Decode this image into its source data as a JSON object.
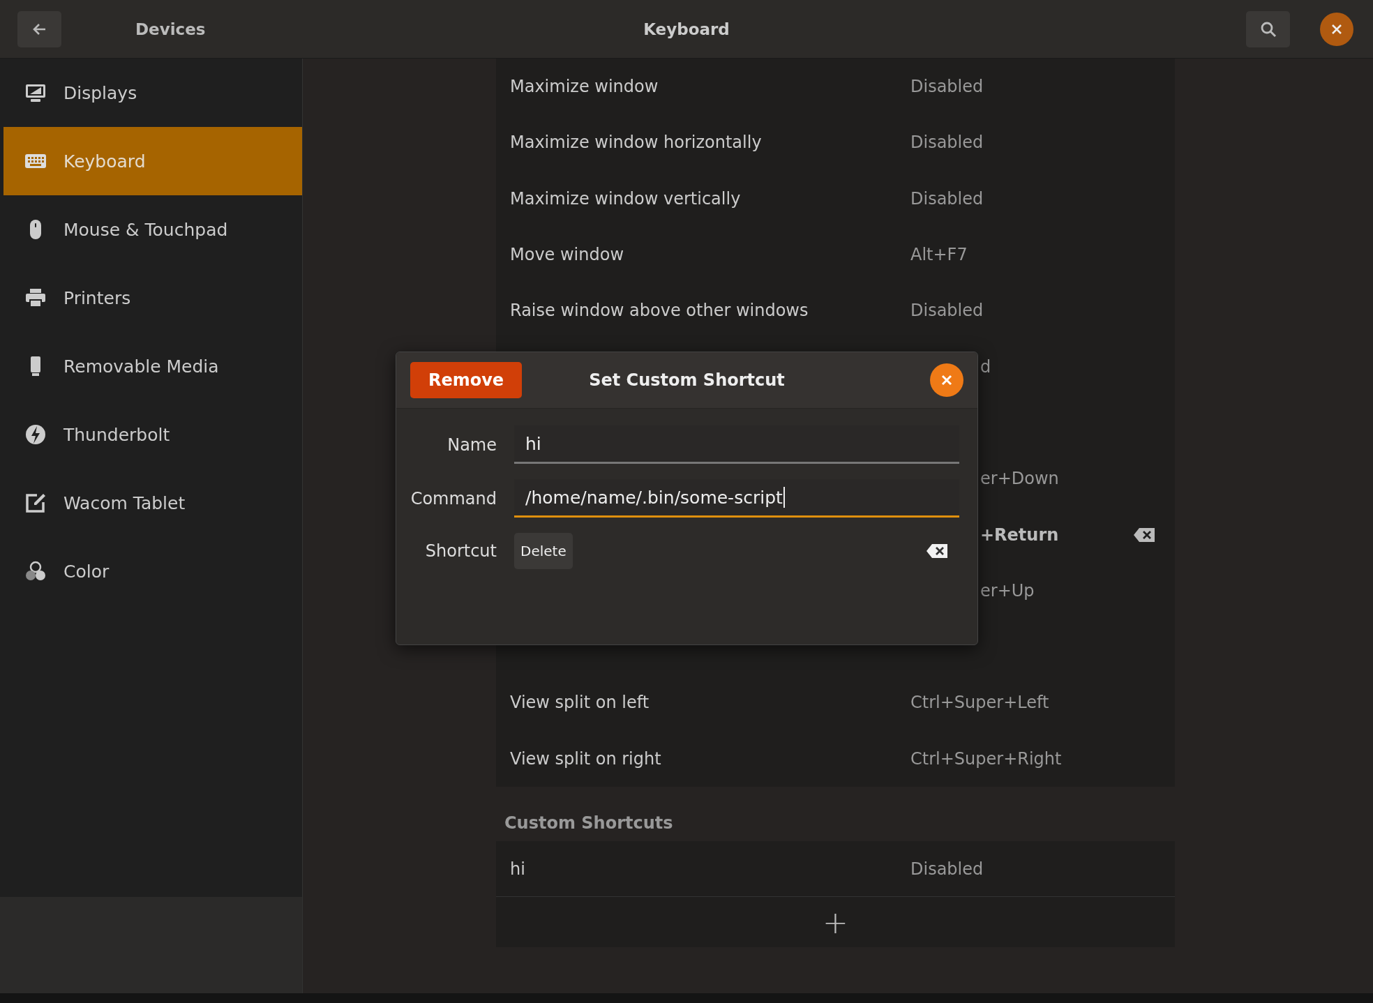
{
  "header": {
    "back_label": "Devices",
    "title": "Keyboard"
  },
  "sidebar": {
    "items": [
      {
        "label": "Displays",
        "kind": "display",
        "selected": false
      },
      {
        "label": "Keyboard",
        "kind": "keyboard",
        "selected": true
      },
      {
        "label": "Mouse & Touchpad",
        "kind": "mouse",
        "selected": false
      },
      {
        "label": "Printers",
        "kind": "printer",
        "selected": false
      },
      {
        "label": "Removable Media",
        "kind": "media",
        "selected": false
      },
      {
        "label": "Thunderbolt",
        "kind": "bolt",
        "selected": false
      },
      {
        "label": "Wacom Tablet",
        "kind": "tablet",
        "selected": false
      },
      {
        "label": "Color",
        "kind": "color",
        "selected": false
      }
    ]
  },
  "shortcuts": {
    "rows": [
      {
        "kind": "normal",
        "name": "Maximize window",
        "shortcut": "Disabled"
      },
      {
        "kind": "normal",
        "name": "Maximize window horizontally",
        "shortcut": "Disabled"
      },
      {
        "kind": "normal",
        "name": "Maximize window vertically",
        "shortcut": "Disabled"
      },
      {
        "kind": "normal",
        "name": "Move window",
        "shortcut": "Alt+F7"
      },
      {
        "kind": "normal",
        "name": "Raise window above other windows",
        "shortcut": "Disabled"
      },
      {
        "kind": "covered",
        "shortcut": "d"
      },
      {
        "kind": "hidden"
      },
      {
        "kind": "covered",
        "shortcut": "er+Down"
      },
      {
        "kind": "editing",
        "shortcut": "+Return"
      },
      {
        "kind": "covered",
        "shortcut": "er+Up"
      },
      {
        "kind": "hidden"
      },
      {
        "kind": "normal",
        "name": "View split on left",
        "shortcut": "Ctrl+Super+Left"
      },
      {
        "kind": "normal",
        "name": "View split on right",
        "shortcut": "Ctrl+Super+Right"
      }
    ]
  },
  "custom": {
    "heading": "Custom Shortcuts",
    "rows": [
      {
        "name": "hi",
        "shortcut": "Disabled"
      }
    ],
    "add_label": "+"
  },
  "dialog": {
    "title": "Set Custom Shortcut",
    "remove_label": "Remove",
    "fields": [
      {
        "label": "Name",
        "value": "hi",
        "focused": false
      },
      {
        "label": "Command",
        "value": "/home/name/.bin/some-script",
        "focused": true
      }
    ],
    "shortcut": {
      "label": "Shortcut",
      "key": "Delete"
    }
  }
}
